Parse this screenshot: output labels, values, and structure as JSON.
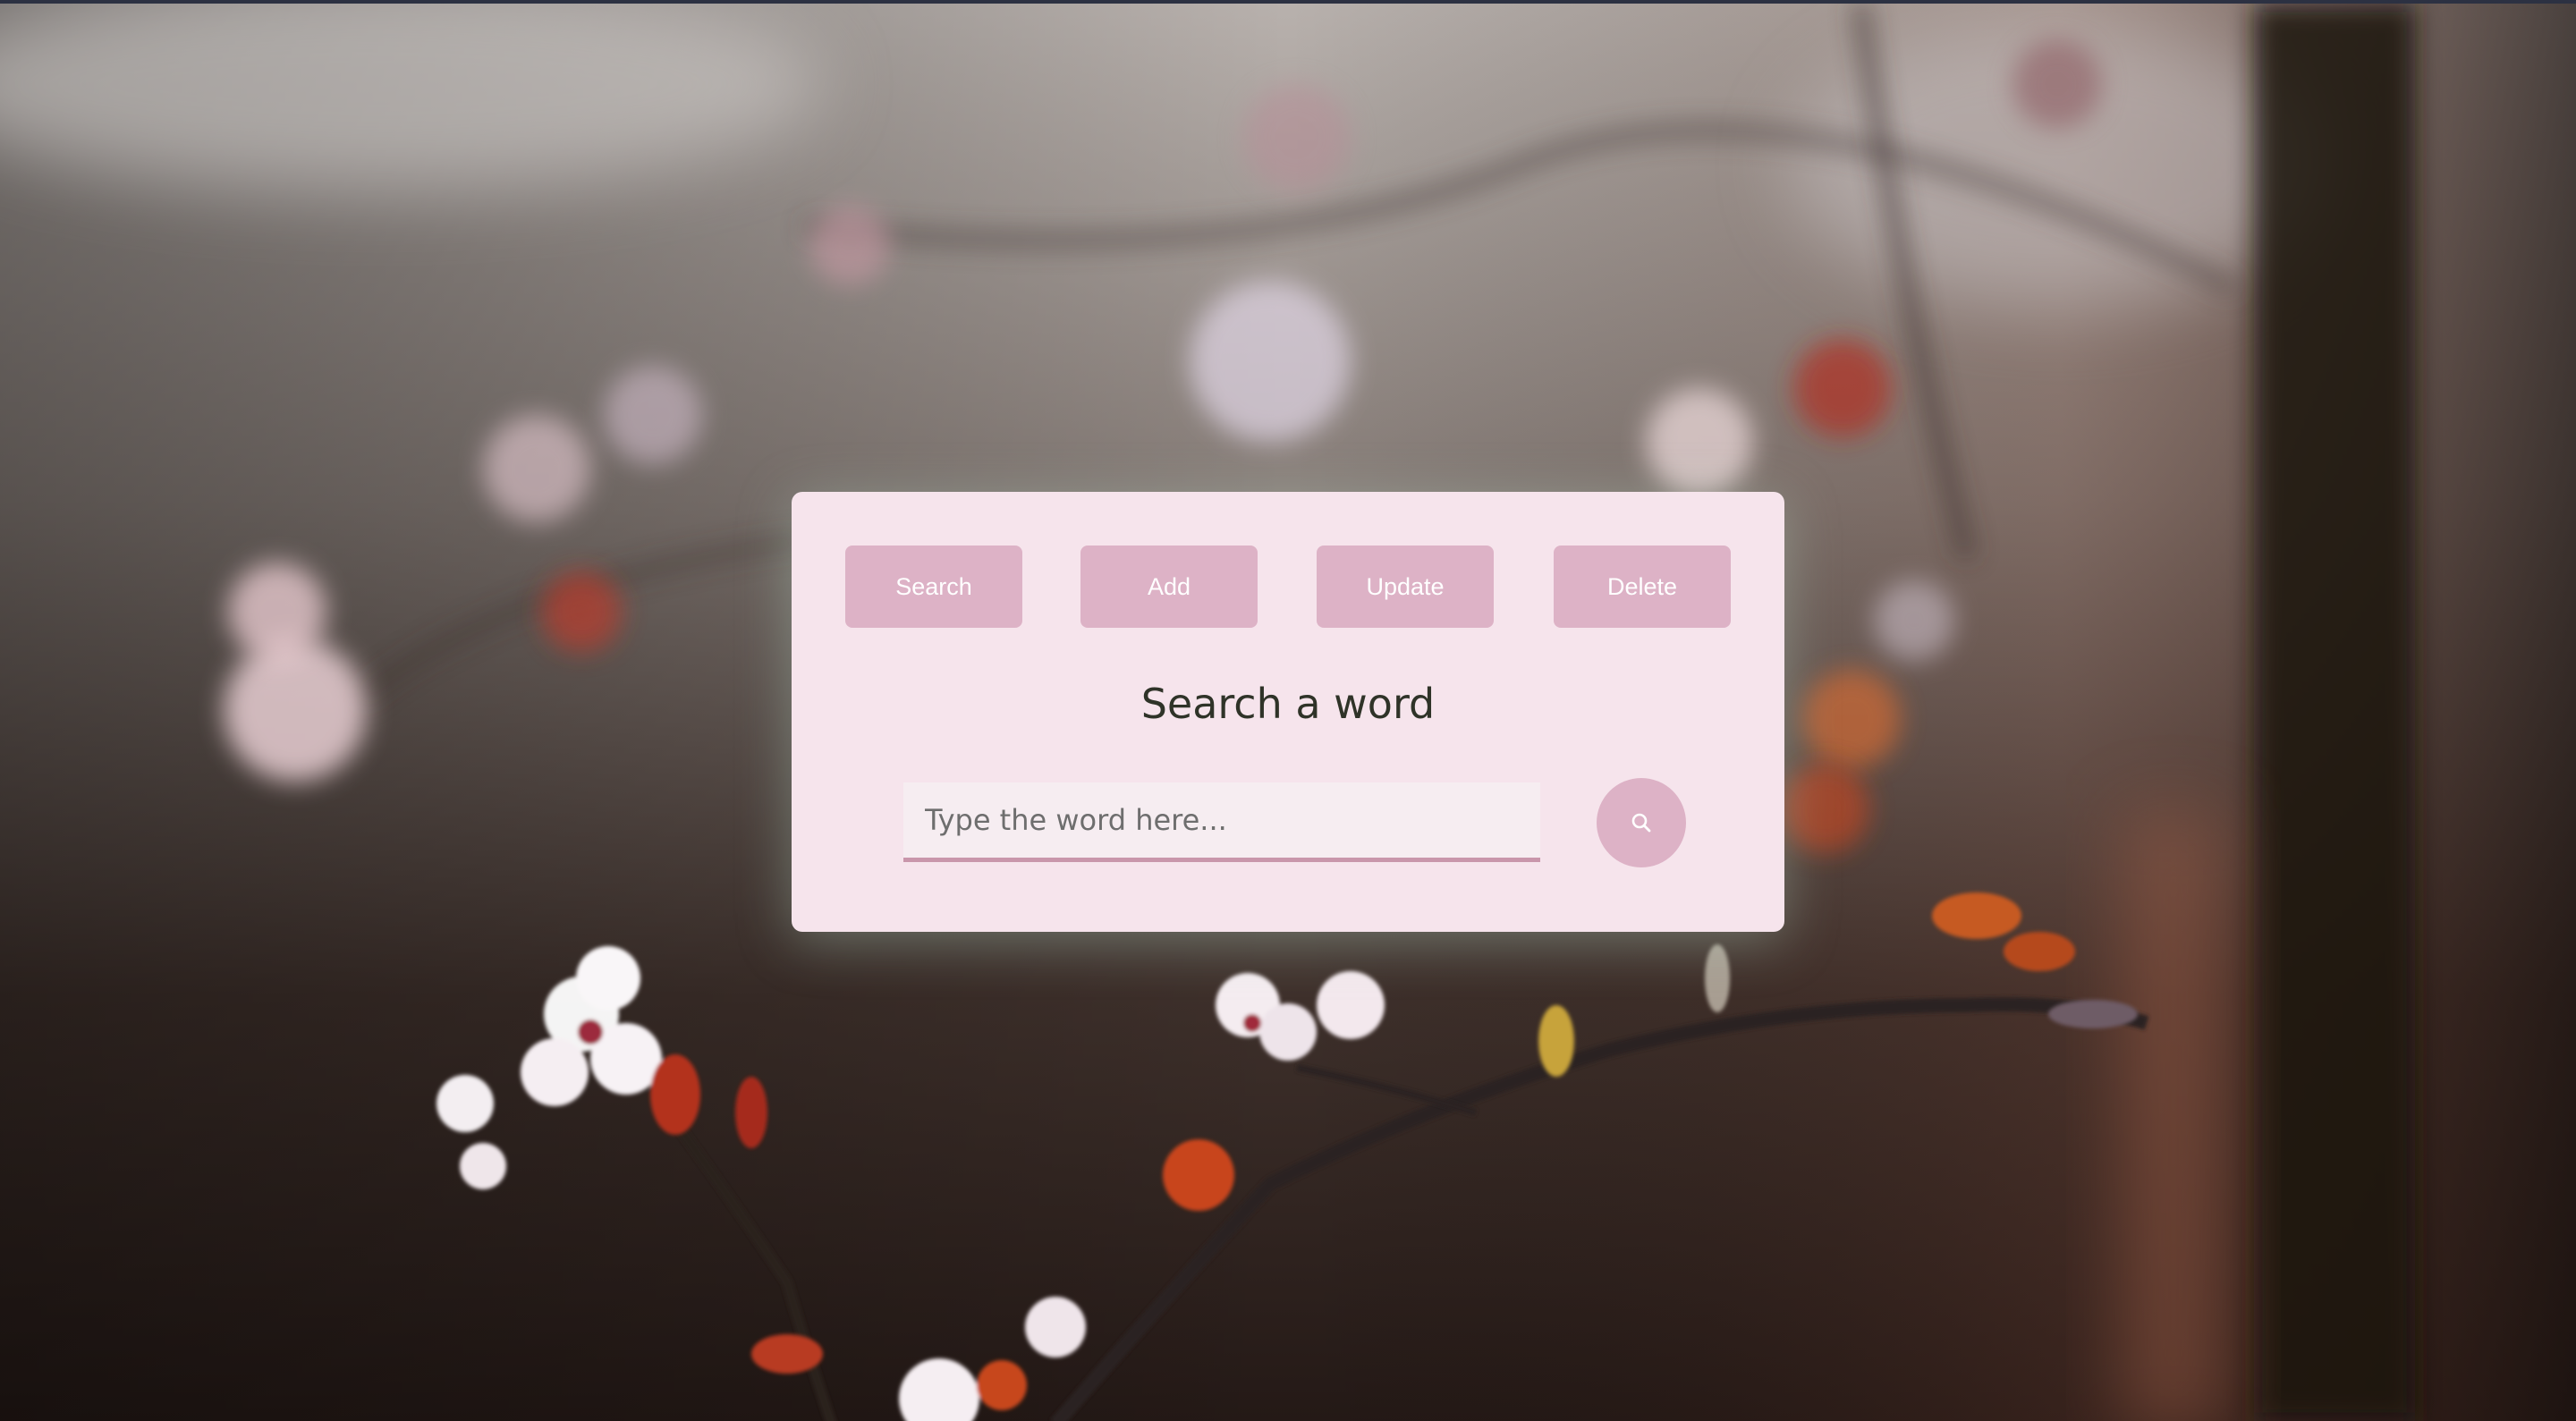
{
  "toolbar": {
    "search_label": "Search",
    "add_label": "Add",
    "update_label": "Update",
    "delete_label": "Delete"
  },
  "main": {
    "title": "Search a word",
    "input_placeholder": "Type the word here...",
    "input_value": "",
    "submit_icon": "search-icon"
  },
  "colors": {
    "panel_bg": "#f6e4ec",
    "button_bg": "#ddb2c6",
    "button_text": "#ffffff",
    "title_text": "#2f3328",
    "input_underline": "#c996ab"
  },
  "background": {
    "subject": "blurred cherry blossom branch photo"
  }
}
